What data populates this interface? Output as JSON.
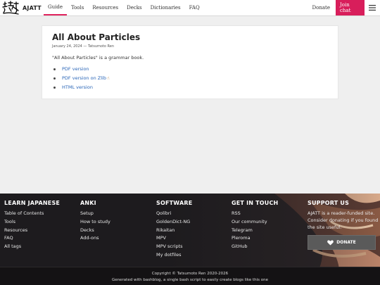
{
  "nav": {
    "brand": "AJATT",
    "links": [
      "Guide",
      "Tools",
      "Resources",
      "Decks",
      "Dictionaries",
      "FAQ"
    ],
    "donate_label": "Donate",
    "join_label": "Join chat",
    "accent_color": "#d81e5b"
  },
  "post": {
    "title": "All About Particles",
    "meta": "January 24, 2024 — Tatsumoto Ren",
    "description": "\"All About Particles\" is a grammar book.",
    "links": [
      "PDF version",
      "PDF version on Zlib",
      "HTML version"
    ]
  },
  "footer": {
    "learn": {
      "title": "LEARN JAPANESE",
      "items": [
        "Table of Contents",
        "Tools",
        "Resources",
        "FAQ",
        "All tags"
      ]
    },
    "anki": {
      "title": "ANKI",
      "items": [
        "Setup",
        "How to study",
        "Decks",
        "Add-ons"
      ]
    },
    "software": {
      "title": "SOFTWARE",
      "items": [
        "Qolibri",
        "GoldenDict-NG",
        "Rikaitan",
        "MPV",
        "MPV scripts",
        "My dotfiles"
      ]
    },
    "touch": {
      "title": "GET IN TOUCH",
      "items": [
        "RSS",
        "Our community",
        "Telegram",
        "Pleroma",
        "GitHub"
      ]
    },
    "support": {
      "title": "SUPPORT US",
      "text": "AJATT is a reader-funded site. Consider donating if you found the site useful.",
      "button": "DONATE"
    },
    "copyright": "Copyright © Tatsumoto Ren 2020-2026",
    "generated": "Generated with bashblog, a single bash script to easily create blogs like this one"
  }
}
